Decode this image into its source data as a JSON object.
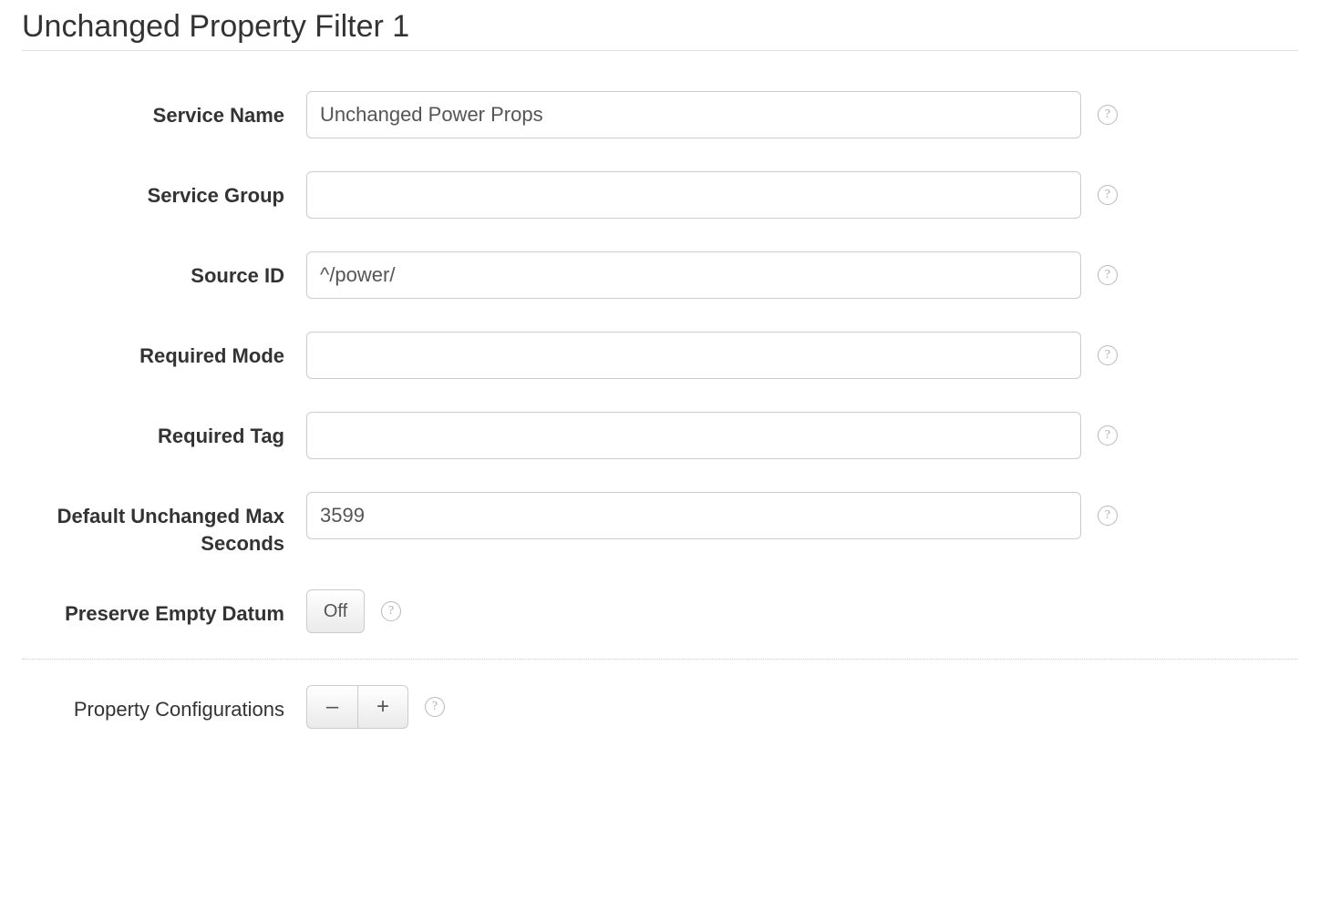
{
  "section": {
    "title": "Unchanged Property Filter 1"
  },
  "fields": {
    "serviceName": {
      "label": "Service Name",
      "value": "Unchanged Power Props"
    },
    "serviceGroup": {
      "label": "Service Group",
      "value": ""
    },
    "sourceId": {
      "label": "Source ID",
      "value": "^/power/"
    },
    "requiredMode": {
      "label": "Required Mode",
      "value": ""
    },
    "requiredTag": {
      "label": "Required Tag",
      "value": ""
    },
    "defaultUnchangedMaxSeconds": {
      "label": "Default Unchanged Max Seconds",
      "value": "3599"
    },
    "preserveEmptyDatum": {
      "label": "Preserve Empty Datum",
      "state": "Off"
    }
  },
  "propertyConfigurations": {
    "label": "Property Configurations",
    "minusLabel": "–",
    "plusLabel": "+"
  },
  "helpGlyph": "?"
}
